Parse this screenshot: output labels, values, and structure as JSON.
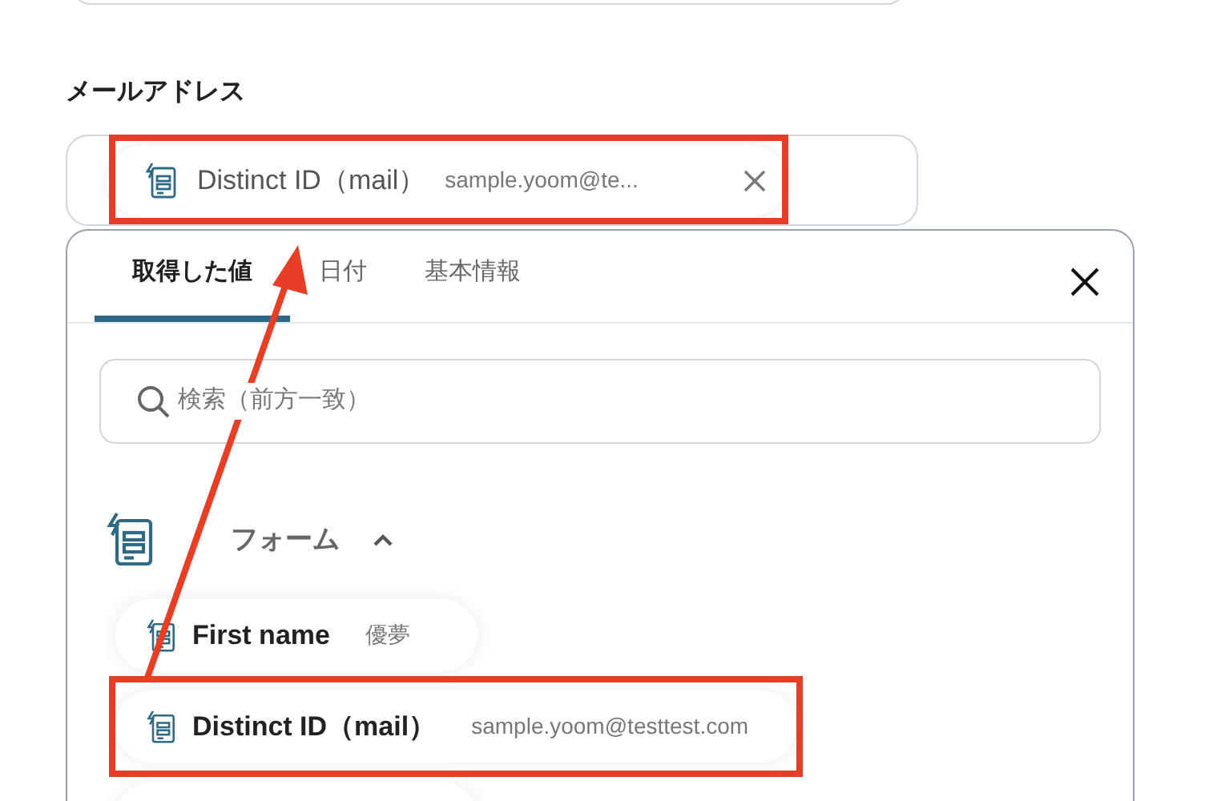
{
  "field": {
    "label": "メールアドレス",
    "chip": {
      "name": "Distinct ID（mail）",
      "value": "sample.yoom@te...",
      "highlighted": true
    }
  },
  "popup": {
    "tabs": [
      {
        "label": "取得した値",
        "selected": true
      },
      {
        "label": "日付",
        "selected": false
      },
      {
        "label": "基本情報",
        "selected": false
      }
    ],
    "search": {
      "placeholder": "検索（前方一致）"
    },
    "section": {
      "title": "フォーム",
      "expanded": true,
      "items": [
        {
          "name": "First name",
          "value": "優夢",
          "highlighted": false
        },
        {
          "name": "Distinct ID（mail）",
          "value": "sample.yoom@testtest.com",
          "highlighted": true
        }
      ]
    }
  }
}
